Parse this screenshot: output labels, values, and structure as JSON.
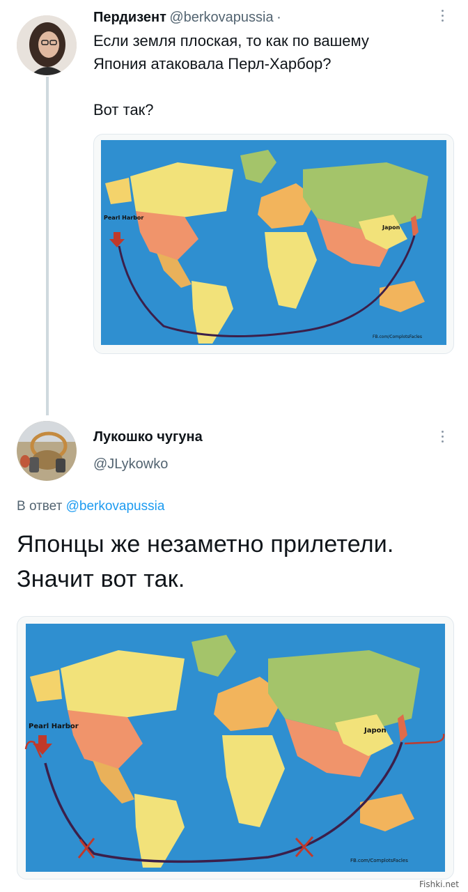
{
  "tweet1": {
    "author_name": "Пердизент",
    "author_handle": "@berkovapussia",
    "separator": "·",
    "text": "Если земля плоская, то как по вашему\nЯпония атаковала Перл-Харбор?\n\nВот так?",
    "map": {
      "label_pearl": "Pearl Harbor",
      "label_japan": "Japon",
      "credit": "FB.com/ComplotsFacles"
    }
  },
  "tweet2": {
    "author_name": "Лукошко чугуна",
    "author_handle": "@JLykowko",
    "reply_prefix": "В ответ",
    "reply_handle": "@berkovapussia",
    "text": "Японцы же незаметно прилетели.\nЗначит вот так.",
    "map": {
      "label_pearl": "Pearl Harbor",
      "label_japan": "Japon",
      "credit": "FB.com/ComplotsFacles"
    }
  },
  "watermark": "Fishki.net",
  "colors": {
    "ocean": "#2f8fd0",
    "route": "#3b1f4a",
    "marker": "#c0392b",
    "link": "#1d9bf0"
  }
}
